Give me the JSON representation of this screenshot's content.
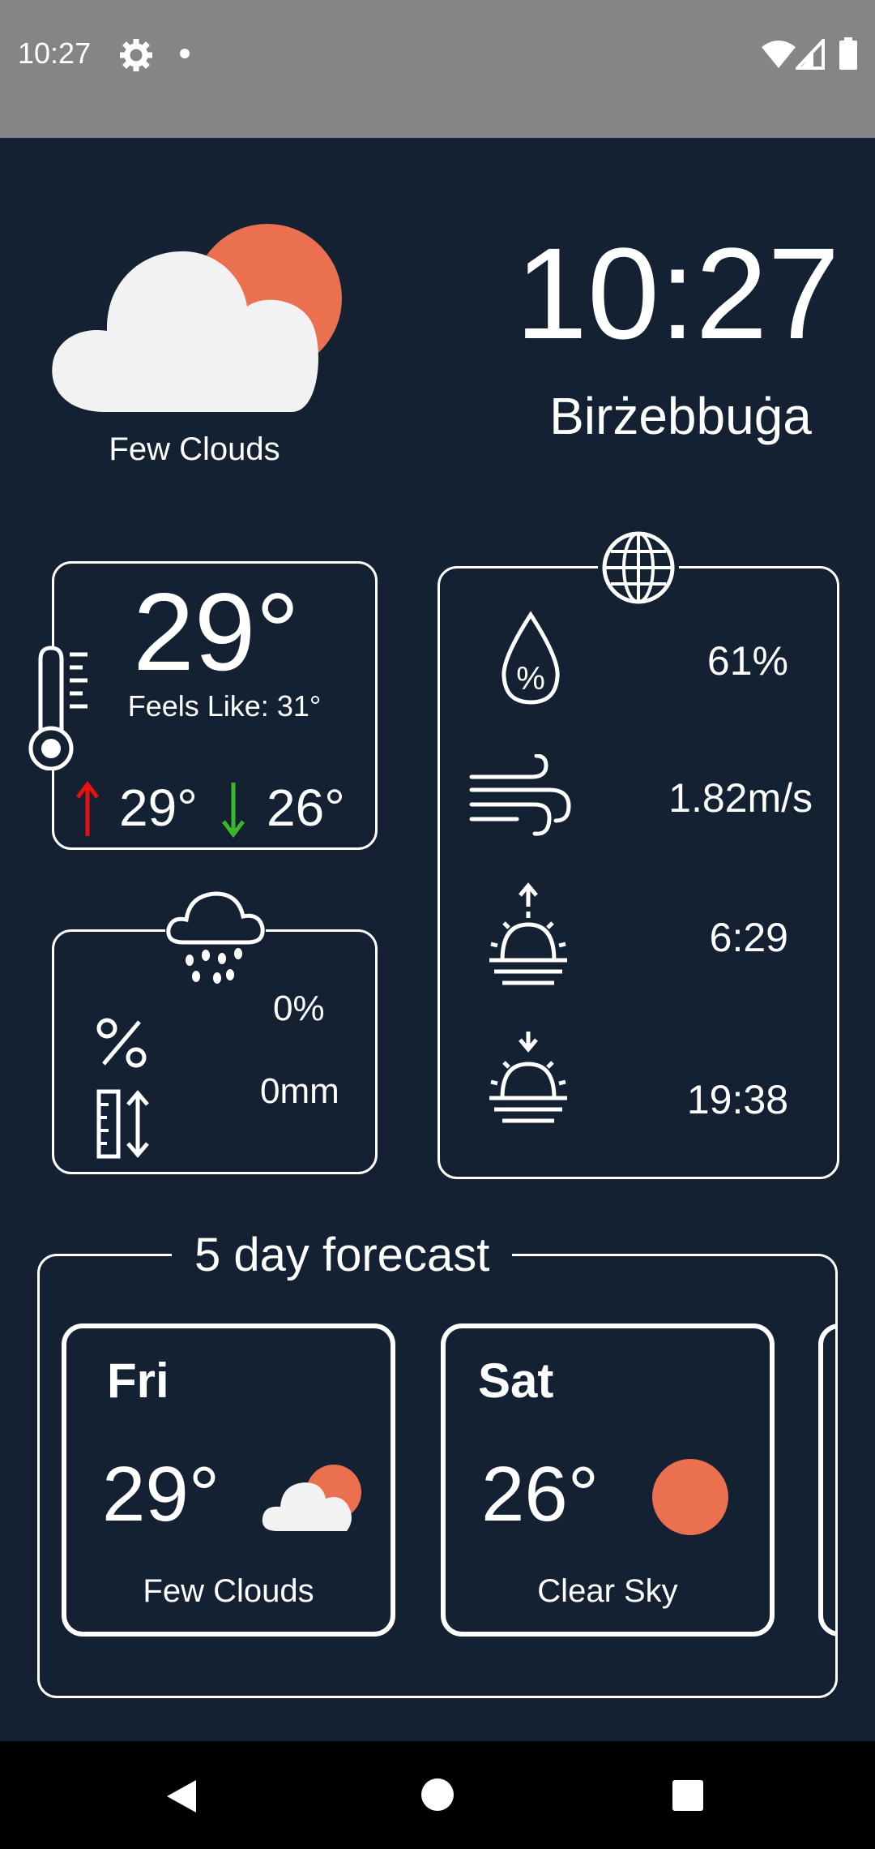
{
  "status_bar": {
    "time": "10:27"
  },
  "current": {
    "condition": "Few Clouds",
    "clock": "10:27",
    "city": "Birżebbuġa",
    "temperature": "29°",
    "feels_like": "Feels Like: 31°",
    "high": "29°",
    "low": "26°"
  },
  "precipitation": {
    "probability": "0%",
    "amount": "0mm"
  },
  "details": {
    "humidity": "61%",
    "wind": "1.82m/s",
    "sunrise": "6:29",
    "sunset": "19:38"
  },
  "forecast": {
    "title": "5 day forecast",
    "days": [
      {
        "day": "Fri",
        "temp": "29°",
        "condition": "Few Clouds",
        "icon": "few-clouds-icon"
      },
      {
        "day": "Sat",
        "temp": "26°",
        "condition": "Clear Sky",
        "icon": "sun-icon"
      }
    ]
  },
  "colors": {
    "background": "#132133",
    "sun": "#EA7050",
    "cloud": "#F2F2F2",
    "high_arrow": "#E81010",
    "low_arrow": "#39B829"
  }
}
